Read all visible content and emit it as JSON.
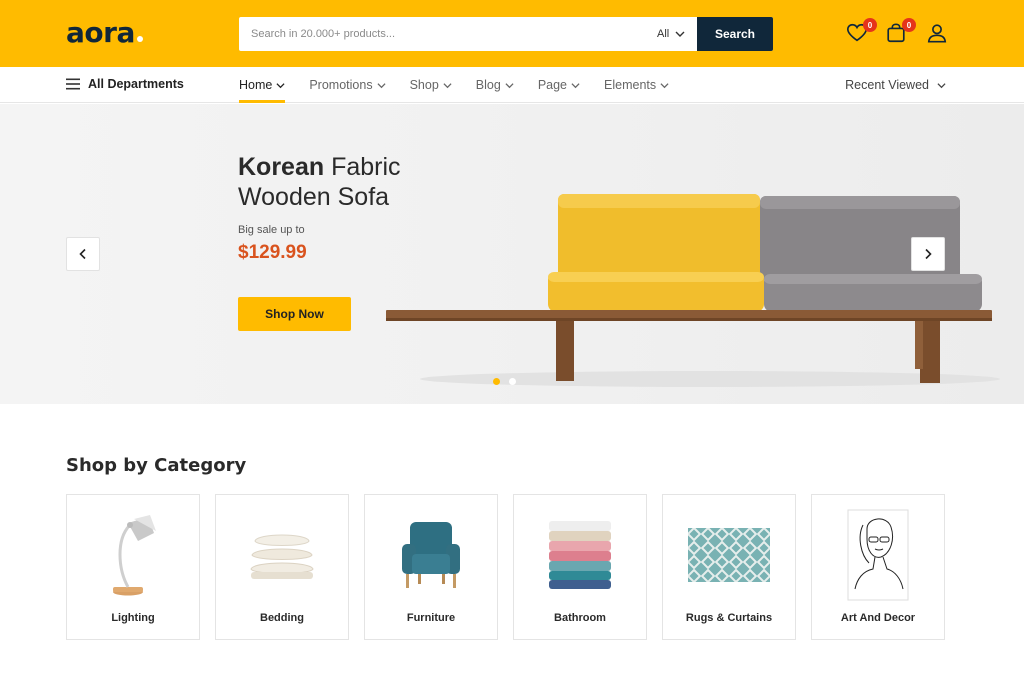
{
  "header": {
    "logo_text": "aora",
    "search": {
      "placeholder": "Search in 20.000+ products...",
      "category": "All",
      "button_label": "Search"
    },
    "wishlist_count": "0",
    "cart_count": "0",
    "icons": [
      "heart-icon",
      "shopping-bag-icon",
      "user-icon"
    ]
  },
  "nav": {
    "all_departments": "All Departments",
    "items": [
      {
        "label": "Home",
        "active": true
      },
      {
        "label": "Promotions"
      },
      {
        "label": "Shop"
      },
      {
        "label": "Blog"
      },
      {
        "label": "Page"
      },
      {
        "label": "Elements"
      }
    ],
    "recent_viewed": "Recent Viewed"
  },
  "hero": {
    "title_bold": "Korean",
    "title_rest_line1": "Fabric",
    "title_line2": "Wooden Sofa",
    "subtitle": "Big sale up to",
    "price": "$129.99",
    "button_label": "Shop Now",
    "slides": 2,
    "active_slide": 1
  },
  "categories": {
    "title": "Shop by Category",
    "items": [
      {
        "label": "Lighting",
        "icon": "lamp-icon"
      },
      {
        "label": "Bedding",
        "icon": "pillows-icon"
      },
      {
        "label": "Furniture",
        "icon": "armchair-icon"
      },
      {
        "label": "Bathroom",
        "icon": "towels-icon"
      },
      {
        "label": "Rugs & Curtains",
        "icon": "rug-icon"
      },
      {
        "label": "Art And Decor",
        "icon": "art-print-icon"
      }
    ]
  },
  "colors": {
    "brand_yellow": "#ffbb00",
    "navy": "#10273a",
    "price_orange": "#d9531e",
    "badge_red": "#e5341a"
  }
}
